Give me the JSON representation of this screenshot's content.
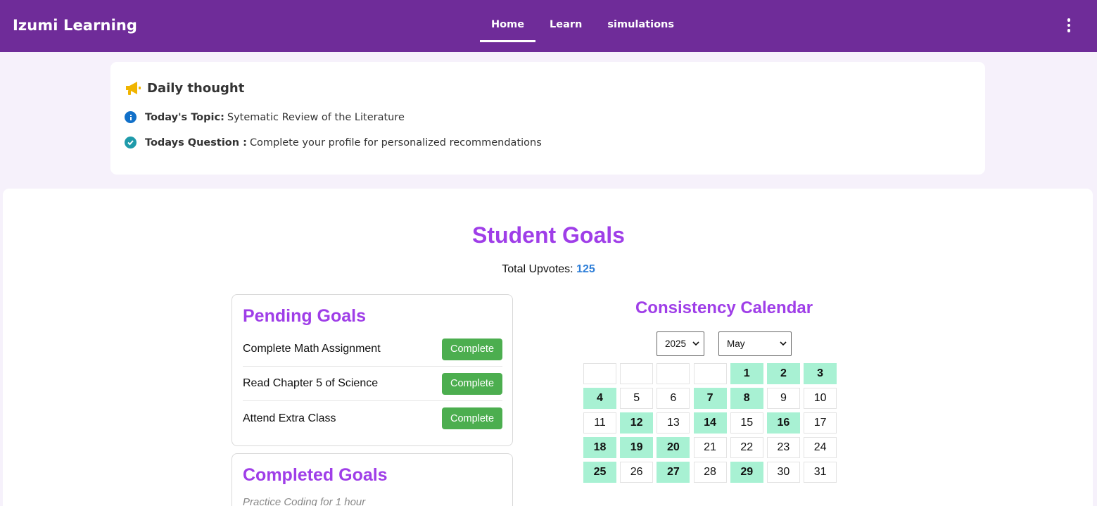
{
  "app": {
    "title": "Izumi Learning"
  },
  "nav": {
    "links": [
      {
        "label": "Home",
        "active": true
      },
      {
        "label": "Learn",
        "active": false
      },
      {
        "label": "simulations",
        "active": false
      }
    ],
    "menu_icon": "kebab-menu-icon"
  },
  "daily_thought": {
    "title": "Daily thought",
    "icon": "megaphone-icon",
    "topic_label": "Today's Topic:",
    "topic_value": "Sytematic Review of the Literature",
    "question_label": "Todays Question :",
    "question_value": "Complete your profile for personalized recommendations"
  },
  "goals": {
    "title": "Student Goals",
    "upvotes_label": "Total Upvotes:",
    "upvotes_value": "125",
    "pending": {
      "title": "Pending Goals",
      "items": [
        {
          "text": "Complete Math Assignment",
          "button": "Complete"
        },
        {
          "text": "Read Chapter 5 of Science",
          "button": "Complete"
        },
        {
          "text": "Attend Extra Class",
          "button": "Complete"
        }
      ]
    },
    "completed": {
      "title": "Completed Goals",
      "items": [
        "Practice Coding for 1 hour"
      ]
    }
  },
  "calendar": {
    "title": "Consistency Calendar",
    "year": "2025",
    "month": "May",
    "leading_blanks": 4,
    "days": [
      "1",
      "2",
      "3",
      "4",
      "5",
      "6",
      "7",
      "8",
      "9",
      "10",
      "11",
      "12",
      "13",
      "14",
      "15",
      "16",
      "17",
      "18",
      "19",
      "20",
      "21",
      "22",
      "23",
      "24",
      "25",
      "26",
      "27",
      "28",
      "29",
      "30",
      "31"
    ],
    "active_days": [
      1,
      2,
      3,
      4,
      7,
      8,
      12,
      14,
      16,
      18,
      19,
      20,
      25,
      27,
      29
    ]
  },
  "colors": {
    "navbar": "#6f2c99",
    "accent_purple": "#9f3ee8",
    "complete_button": "#4cae4f",
    "active_day": "#a8f1d3",
    "upvote_count": "#2f7fd8"
  }
}
